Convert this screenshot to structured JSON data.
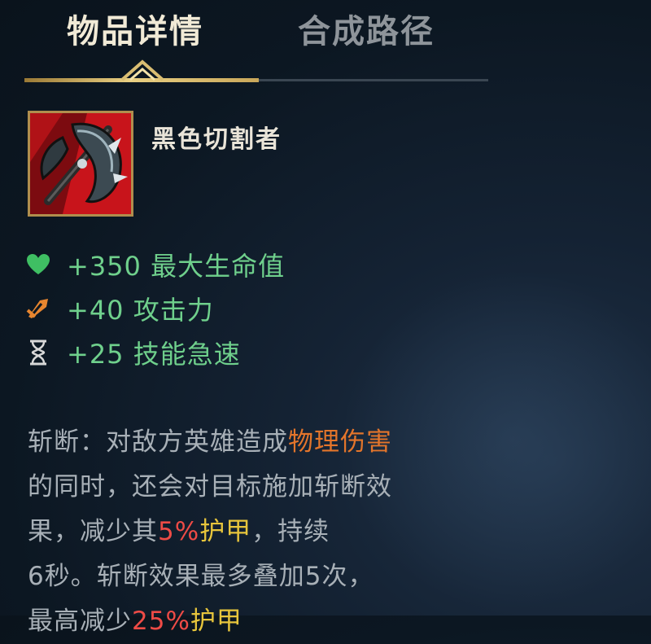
{
  "tabs": [
    {
      "label": "物品详情",
      "active": true
    },
    {
      "label": "合成路径",
      "active": false
    }
  ],
  "item": {
    "name": "黑色切割者",
    "icon": "black-cleaver-axe-icon"
  },
  "stats": [
    {
      "icon": "heart-icon",
      "text": "+350 最大生命值",
      "icon_color": "#3fbf63"
    },
    {
      "icon": "sword-attack-icon",
      "text": "+40 攻击力",
      "icon_color": "#e8862f"
    },
    {
      "icon": "hourglass-icon",
      "text": "+25 技能急速",
      "icon_color": "#d8d8d8"
    }
  ],
  "description": {
    "lines": [
      [
        {
          "text": "斩断：对敌方英雄造成",
          "style": "plain"
        },
        {
          "text": "物理伤害",
          "style": "orange"
        }
      ],
      [
        {
          "text": "的同时，还会对目标施加斩断效",
          "style": "plain"
        }
      ],
      [
        {
          "text": "果，减少其",
          "style": "plain"
        },
        {
          "text": "5%",
          "style": "red"
        },
        {
          "text": "护甲",
          "style": "gold"
        },
        {
          "text": "，持续",
          "style": "plain"
        }
      ],
      [
        {
          "text": "6秒。斩断效果最多叠加5次，",
          "style": "plain"
        }
      ],
      [
        {
          "text": "最高减少",
          "style": "plain"
        },
        {
          "text": "25%",
          "style": "red"
        },
        {
          "text": "护甲",
          "style": "gold"
        }
      ]
    ]
  },
  "colors": {
    "stat_text": "#6fd08c",
    "accent_gold": "#e9cf82",
    "physical_damage": "#e3752b",
    "percent": "#ee4b46",
    "armor": "#e7c53c"
  }
}
